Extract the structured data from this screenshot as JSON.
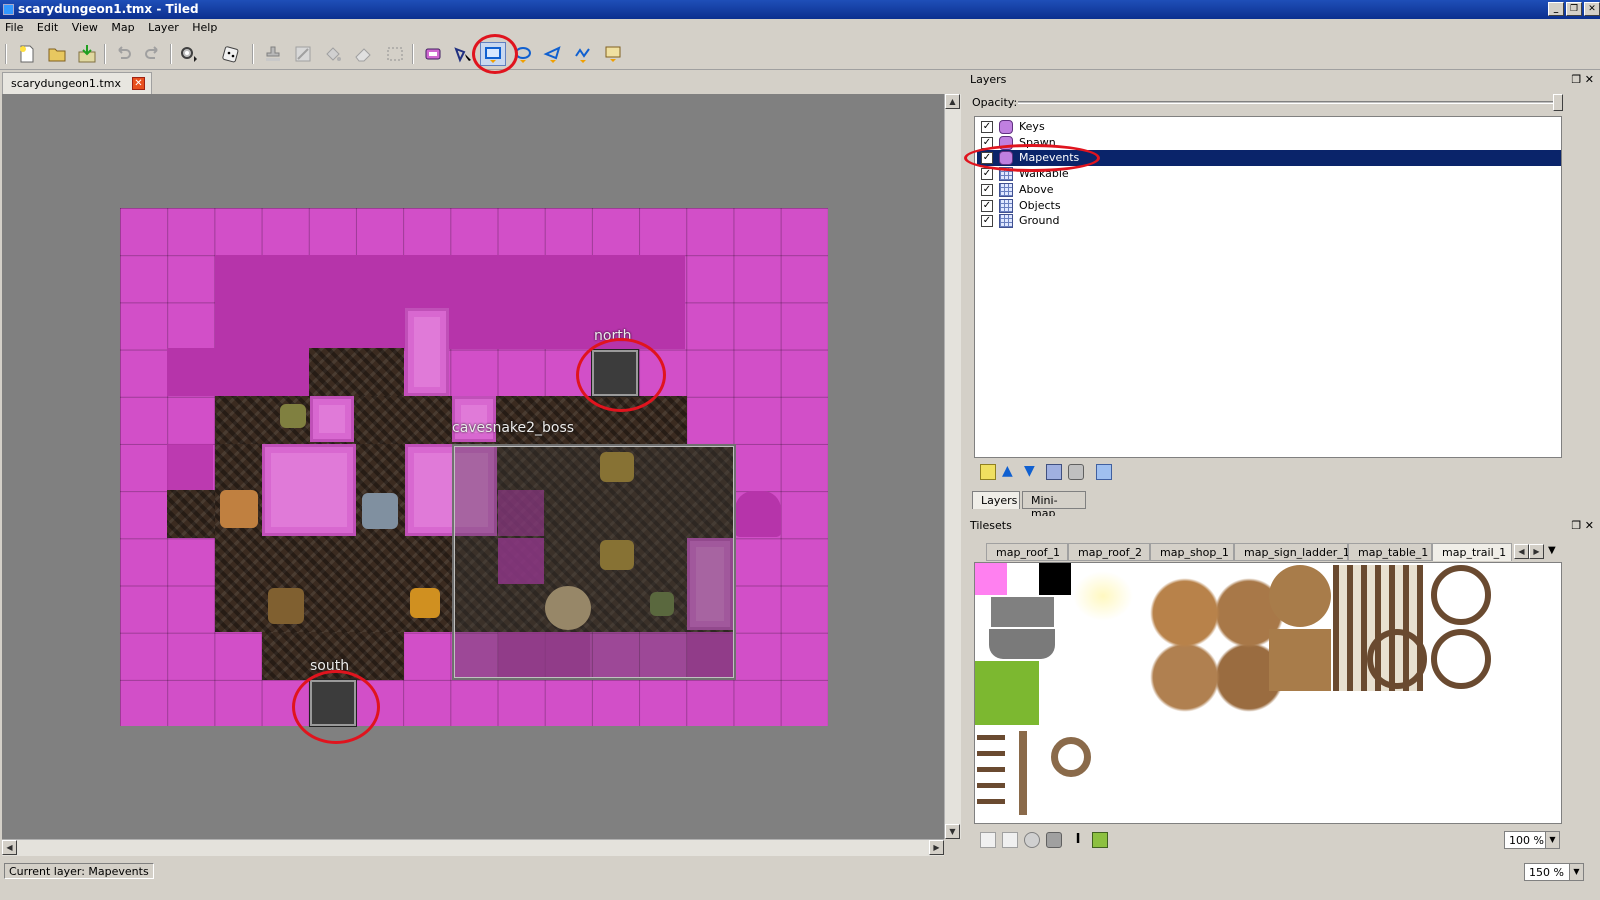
{
  "window": {
    "title": "scarydungeon1.tmx - Tiled",
    "controls": [
      "_",
      "❐",
      "✕"
    ]
  },
  "menu": [
    "File",
    "Edit",
    "View",
    "Map",
    "Layer",
    "Help"
  ],
  "toolbar_icons": [
    "new-file-icon",
    "open-file-icon",
    "save-file-icon",
    "undo-icon",
    "redo-icon",
    "automap-icon",
    "random-mode-icon",
    "stamp-brush-icon",
    "terrain-brush-icon",
    "bucket-fill-icon",
    "eraser-icon",
    "rectangle-select-icon",
    "magic-wand-icon",
    "select-objects-icon",
    "edit-polygons-icon",
    "insert-rectangle-icon",
    "insert-ellipse-icon",
    "insert-polygon-icon",
    "insert-polyline-icon",
    "insert-tile-icon"
  ],
  "document": {
    "tab": "scarydungeon1.tmx",
    "close": "✕"
  },
  "map_objects": {
    "north": "north",
    "south": "south",
    "boss": "cavesnake2_boss"
  },
  "layers_panel": {
    "title": "Layers",
    "opacity_label": "Opacity:",
    "opacity": 1.0,
    "layers": [
      {
        "name": "Keys",
        "type": "object",
        "checked": true,
        "selected": false
      },
      {
        "name": "Spawn",
        "type": "object",
        "checked": true,
        "selected": false
      },
      {
        "name": "Mapevents",
        "type": "object",
        "checked": true,
        "selected": true
      },
      {
        "name": "Walkable",
        "type": "tile",
        "checked": true,
        "selected": false
      },
      {
        "name": "Above",
        "type": "tile",
        "checked": true,
        "selected": false
      },
      {
        "name": "Objects",
        "type": "tile",
        "checked": true,
        "selected": false
      },
      {
        "name": "Ground",
        "type": "tile",
        "checked": true,
        "selected": false
      }
    ],
    "tabs": [
      "Layers",
      "Mini-map"
    ]
  },
  "tilesets_panel": {
    "title": "Tilesets",
    "tabs": [
      "map_roof_1",
      "map_roof_2",
      "map_shop_1",
      "map_sign_ladder_1",
      "map_table_1",
      "map_trail_1"
    ],
    "active_tab": "map_trail_1",
    "zoom": "100 %"
  },
  "status": {
    "current_layer": "Current layer: Mapevents",
    "zoom": "150 %"
  },
  "colors": {
    "map_bg": "#d24fc8",
    "selection": "#0a246a",
    "highlight_circle": "#e0141e"
  }
}
